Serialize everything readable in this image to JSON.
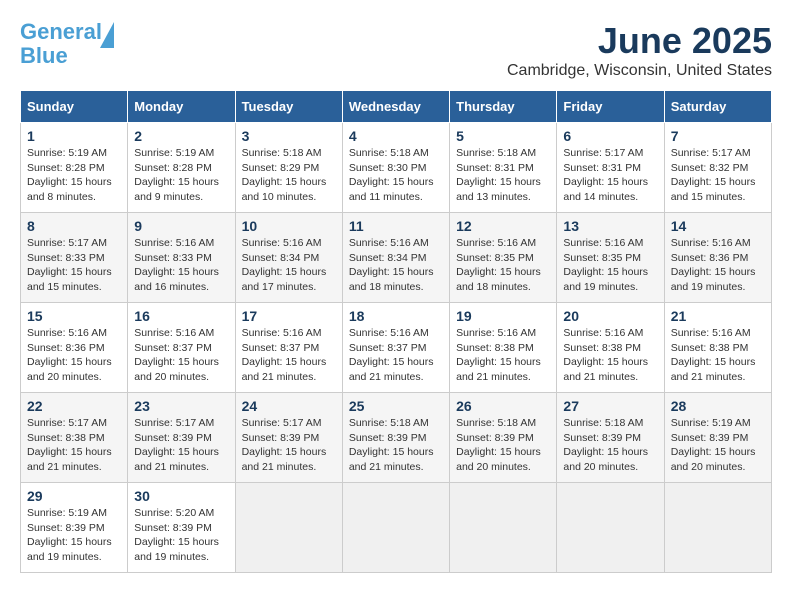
{
  "header": {
    "logo_line1": "General",
    "logo_line2": "Blue",
    "month": "June 2025",
    "location": "Cambridge, Wisconsin, United States"
  },
  "weekdays": [
    "Sunday",
    "Monday",
    "Tuesday",
    "Wednesday",
    "Thursday",
    "Friday",
    "Saturday"
  ],
  "weeks": [
    [
      {
        "day": "1",
        "sunrise": "5:19 AM",
        "sunset": "8:28 PM",
        "daylight": "15 hours and 8 minutes."
      },
      {
        "day": "2",
        "sunrise": "5:19 AM",
        "sunset": "8:28 PM",
        "daylight": "15 hours and 9 minutes."
      },
      {
        "day": "3",
        "sunrise": "5:18 AM",
        "sunset": "8:29 PM",
        "daylight": "15 hours and 10 minutes."
      },
      {
        "day": "4",
        "sunrise": "5:18 AM",
        "sunset": "8:30 PM",
        "daylight": "15 hours and 11 minutes."
      },
      {
        "day": "5",
        "sunrise": "5:18 AM",
        "sunset": "8:31 PM",
        "daylight": "15 hours and 13 minutes."
      },
      {
        "day": "6",
        "sunrise": "5:17 AM",
        "sunset": "8:31 PM",
        "daylight": "15 hours and 14 minutes."
      },
      {
        "day": "7",
        "sunrise": "5:17 AM",
        "sunset": "8:32 PM",
        "daylight": "15 hours and 15 minutes."
      }
    ],
    [
      {
        "day": "8",
        "sunrise": "5:17 AM",
        "sunset": "8:33 PM",
        "daylight": "15 hours and 15 minutes."
      },
      {
        "day": "9",
        "sunrise": "5:16 AM",
        "sunset": "8:33 PM",
        "daylight": "15 hours and 16 minutes."
      },
      {
        "day": "10",
        "sunrise": "5:16 AM",
        "sunset": "8:34 PM",
        "daylight": "15 hours and 17 minutes."
      },
      {
        "day": "11",
        "sunrise": "5:16 AM",
        "sunset": "8:34 PM",
        "daylight": "15 hours and 18 minutes."
      },
      {
        "day": "12",
        "sunrise": "5:16 AM",
        "sunset": "8:35 PM",
        "daylight": "15 hours and 18 minutes."
      },
      {
        "day": "13",
        "sunrise": "5:16 AM",
        "sunset": "8:35 PM",
        "daylight": "15 hours and 19 minutes."
      },
      {
        "day": "14",
        "sunrise": "5:16 AM",
        "sunset": "8:36 PM",
        "daylight": "15 hours and 19 minutes."
      }
    ],
    [
      {
        "day": "15",
        "sunrise": "5:16 AM",
        "sunset": "8:36 PM",
        "daylight": "15 hours and 20 minutes."
      },
      {
        "day": "16",
        "sunrise": "5:16 AM",
        "sunset": "8:37 PM",
        "daylight": "15 hours and 20 minutes."
      },
      {
        "day": "17",
        "sunrise": "5:16 AM",
        "sunset": "8:37 PM",
        "daylight": "15 hours and 21 minutes."
      },
      {
        "day": "18",
        "sunrise": "5:16 AM",
        "sunset": "8:37 PM",
        "daylight": "15 hours and 21 minutes."
      },
      {
        "day": "19",
        "sunrise": "5:16 AM",
        "sunset": "8:38 PM",
        "daylight": "15 hours and 21 minutes."
      },
      {
        "day": "20",
        "sunrise": "5:16 AM",
        "sunset": "8:38 PM",
        "daylight": "15 hours and 21 minutes."
      },
      {
        "day": "21",
        "sunrise": "5:16 AM",
        "sunset": "8:38 PM",
        "daylight": "15 hours and 21 minutes."
      }
    ],
    [
      {
        "day": "22",
        "sunrise": "5:17 AM",
        "sunset": "8:38 PM",
        "daylight": "15 hours and 21 minutes."
      },
      {
        "day": "23",
        "sunrise": "5:17 AM",
        "sunset": "8:39 PM",
        "daylight": "15 hours and 21 minutes."
      },
      {
        "day": "24",
        "sunrise": "5:17 AM",
        "sunset": "8:39 PM",
        "daylight": "15 hours and 21 minutes."
      },
      {
        "day": "25",
        "sunrise": "5:18 AM",
        "sunset": "8:39 PM",
        "daylight": "15 hours and 21 minutes."
      },
      {
        "day": "26",
        "sunrise": "5:18 AM",
        "sunset": "8:39 PM",
        "daylight": "15 hours and 20 minutes."
      },
      {
        "day": "27",
        "sunrise": "5:18 AM",
        "sunset": "8:39 PM",
        "daylight": "15 hours and 20 minutes."
      },
      {
        "day": "28",
        "sunrise": "5:19 AM",
        "sunset": "8:39 PM",
        "daylight": "15 hours and 20 minutes."
      }
    ],
    [
      {
        "day": "29",
        "sunrise": "5:19 AM",
        "sunset": "8:39 PM",
        "daylight": "15 hours and 19 minutes."
      },
      {
        "day": "30",
        "sunrise": "5:20 AM",
        "sunset": "8:39 PM",
        "daylight": "15 hours and 19 minutes."
      },
      null,
      null,
      null,
      null,
      null
    ]
  ],
  "labels": {
    "sunrise": "Sunrise:",
    "sunset": "Sunset:",
    "daylight": "Daylight hours"
  }
}
